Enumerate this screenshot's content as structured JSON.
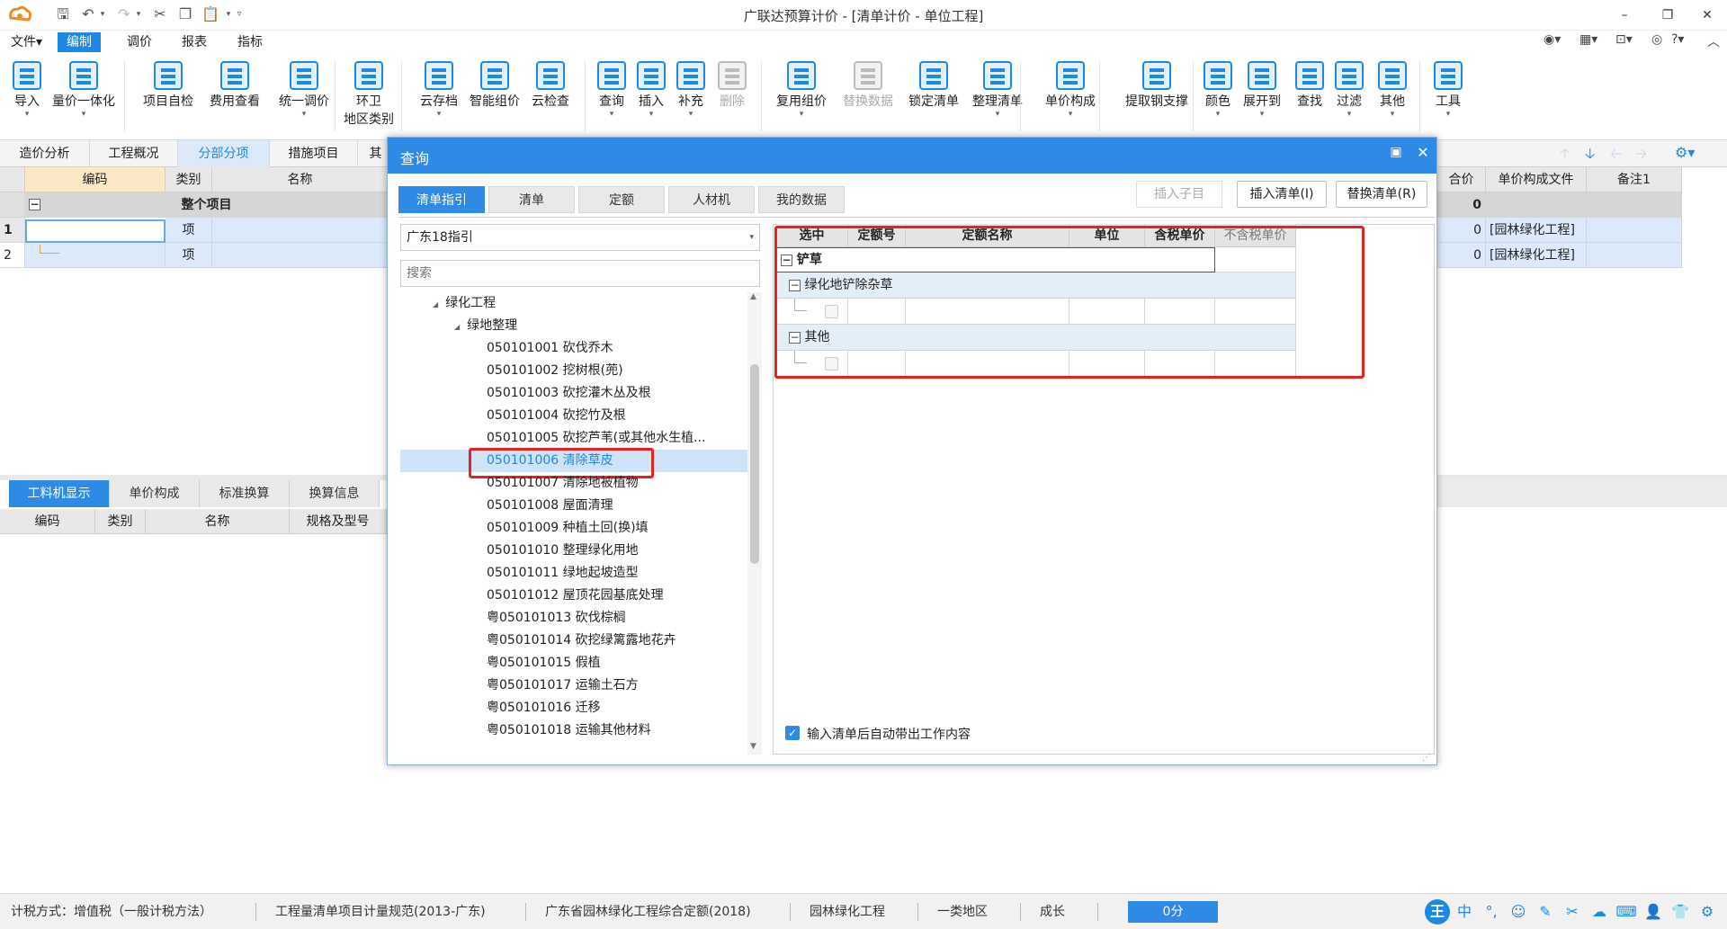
{
  "window": {
    "title": "广联达预算计价 - [清单计价 - 单位工程]"
  },
  "menu": [
    "文件▾",
    "编制",
    "调价",
    "报表",
    "指标"
  ],
  "ribbon": [
    {
      "label": "导入",
      "arrow": true
    },
    {
      "label": "量价一体化",
      "arrow": true
    },
    {
      "label": "项目自检"
    },
    {
      "label": "费用查看"
    },
    {
      "label": "统一调价",
      "arrow": true
    },
    {
      "label": "环卫\n地区类别"
    },
    {
      "label": "云存档",
      "arrow": true
    },
    {
      "label": "智能组价"
    },
    {
      "label": "云检查"
    },
    {
      "label": "查询",
      "arrow": true
    },
    {
      "label": "插入",
      "arrow": true
    },
    {
      "label": "补充",
      "arrow": true
    },
    {
      "label": "删除",
      "disabled": true
    },
    {
      "label": "复用组价",
      "arrow": true
    },
    {
      "label": "替换数据",
      "disabled": true
    },
    {
      "label": "锁定清单"
    },
    {
      "label": "整理清单",
      "arrow": true
    },
    {
      "label": "单价构成",
      "arrow": true
    },
    {
      "label": "提取钢支撑"
    },
    {
      "label": "颜色",
      "arrow": true
    },
    {
      "label": "展开到",
      "arrow": true
    },
    {
      "label": "查找"
    },
    {
      "label": "过滤",
      "arrow": true
    },
    {
      "label": "其他",
      "arrow": true
    },
    {
      "label": "工具",
      "arrow": true
    }
  ],
  "tabs": [
    "造价分析",
    "工程概况",
    "分部分项",
    "措施项目",
    "其"
  ],
  "grid": {
    "headers": [
      "编码",
      "类别",
      "名称"
    ],
    "right_headers": [
      "合价",
      "单价构成文件",
      "备注1"
    ],
    "total_row": {
      "label": "整个项目",
      "value": "0"
    },
    "rows": [
      {
        "num": "1",
        "code": "",
        "type": "项",
        "value": "0",
        "file": "[园林绿化工程]"
      },
      {
        "num": "2",
        "code": "",
        "type": "项",
        "value": "0",
        "file": "[园林绿化工程]"
      }
    ]
  },
  "bottom_tabs": [
    "工料机显示",
    "单价构成",
    "标准换算",
    "换算信息"
  ],
  "bottom_headers": [
    "编码",
    "类别",
    "名称",
    "规格及型号"
  ],
  "dialog": {
    "title": "查询",
    "tabs": [
      "清单指引",
      "清单",
      "定额",
      "人材机",
      "我的数据"
    ],
    "buttons": {
      "insert_child": "插入子目",
      "insert_list": "插入清单(I)",
      "replace_list": "替换清单(R)"
    },
    "dropdown": "广东18指引",
    "search_placeholder": "搜索",
    "tree": [
      {
        "indent": 0,
        "text": "绿化工程",
        "expander": "◢"
      },
      {
        "indent": 1,
        "text": "绿地整理",
        "expander": "◢"
      },
      {
        "indent": 2,
        "text": "050101001  砍伐乔木"
      },
      {
        "indent": 2,
        "text": "050101002  挖树根(蔸)"
      },
      {
        "indent": 2,
        "text": "050101003  砍挖灌木丛及根"
      },
      {
        "indent": 2,
        "text": "050101004  砍挖竹及根"
      },
      {
        "indent": 2,
        "text": "050101005  砍挖芦苇(或其他水生植..."
      },
      {
        "indent": 2,
        "text": "050101006  清除草皮",
        "selected": true
      },
      {
        "indent": 2,
        "text": "050101007  清除地被植物"
      },
      {
        "indent": 2,
        "text": "050101008  屋面清理"
      },
      {
        "indent": 2,
        "text": "050101009  种植土回(换)填"
      },
      {
        "indent": 2,
        "text": "050101010  整理绿化用地"
      },
      {
        "indent": 2,
        "text": "050101011  绿地起坡造型"
      },
      {
        "indent": 2,
        "text": "050101012  屋顶花园基底处理"
      },
      {
        "indent": 2,
        "text": "粤050101013  砍伐棕榈"
      },
      {
        "indent": 2,
        "text": "粤050101014  砍挖绿篱露地花卉"
      },
      {
        "indent": 2,
        "text": "粤050101015  假植"
      },
      {
        "indent": 2,
        "text": "粤050101017  运输土石方"
      },
      {
        "indent": 2,
        "text": "粤050101016  迁移"
      },
      {
        "indent": 2,
        "text": "粤050101018  运输其他材料"
      }
    ],
    "right_headers": [
      "选中",
      "定额号",
      "定额名称",
      "单位",
      "含税单价",
      "不含税单价"
    ],
    "groups": [
      {
        "label": "铲草",
        "level": 0
      },
      {
        "label": "绿化地铲除杂草",
        "level": 1
      },
      {
        "label": "其他",
        "level": 1
      }
    ],
    "checkbox_label": "输入清单后自动带出工作内容"
  },
  "status": [
    "计税方式：增值税（一般计税方法）",
    "工程量清单项目计量规范(2013-广东)",
    "广东省园林绿化工程综合定额(2018)",
    "园林绿化工程",
    "一类地区",
    "成长",
    "0分"
  ],
  "ime": [
    "王",
    "中",
    "°,",
    "☺",
    "✎",
    "✂",
    "☁",
    "⌨",
    "👤",
    "👕",
    "⚙"
  ]
}
